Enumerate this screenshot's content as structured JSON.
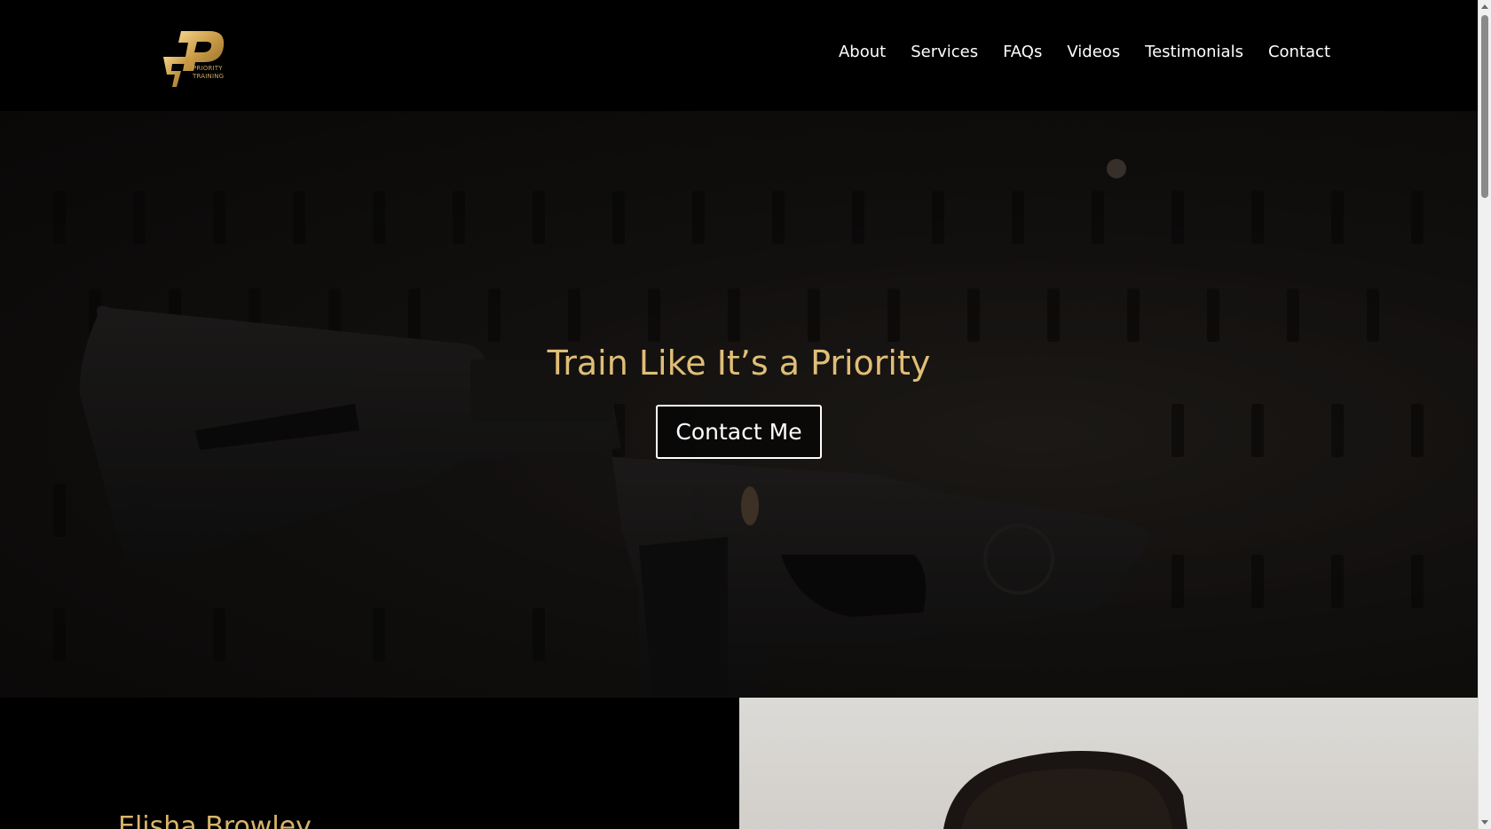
{
  "header": {
    "logo_letter": "P",
    "logo_text_line1": "PRIORITY",
    "logo_text_line2": "TRAINING",
    "nav": [
      {
        "label": "About"
      },
      {
        "label": "Services"
      },
      {
        "label": "FAQs"
      },
      {
        "label": "Videos"
      },
      {
        "label": "Testimonials"
      },
      {
        "label": "Contact"
      }
    ]
  },
  "hero": {
    "title": "Train Like It’s a Priority",
    "button_label": "Contact Me",
    "background": "dark photo of rifle lower receiver and stock"
  },
  "about": {
    "name": "Elisha Browley",
    "photo": "portrait photo"
  },
  "colors": {
    "accent_gold": "#e0be76",
    "background": "#000000",
    "text_light": "#ffffff"
  }
}
